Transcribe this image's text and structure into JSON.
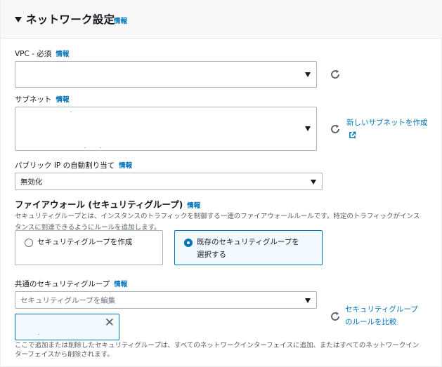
{
  "header": {
    "title": "ネットワーク設定",
    "info": "情報"
  },
  "vpc": {
    "label": "VPC - 必須",
    "info": "情報",
    "value": ""
  },
  "subnet": {
    "label": "サブネット",
    "info": "情報",
    "value": "",
    "create_link": "新しいサブネットを作成"
  },
  "public_ip": {
    "label": "パブリック IP の自動割り当て",
    "info": "情報",
    "value": "無効化"
  },
  "firewall": {
    "title": "ファイアウォール (セキュリティグループ)",
    "info": "情報",
    "description_line1": "セキュリティグループとは、インスタンスのトラフィックを制御する一連のファイアウォールルールです。特定のトラフィックがインス",
    "description_line2": "タンスに到達できるようにルールを追加します。",
    "option_create": "セキュリティグループを作成",
    "option_existing_line1": "既存のセキュリティグループを",
    "option_existing_line2": "選択する",
    "selected_option": "existing"
  },
  "common_sg": {
    "label": "共通のセキュリティグループ",
    "info": "情報",
    "placeholder": "セキュリティグループを編集",
    "compare_link_line1": "セキュリティグループ",
    "compare_link_line2": "のルールを比較",
    "token_value": "",
    "note_line1": "ここで追加または削除したセキュリティグループは、すべてのネットワークインターフェイスに追加、またはすべてのネットワークイン",
    "note_line2": "ターフェイスから削除されます。"
  },
  "icons": {
    "collapse": "caret-down-icon",
    "dropdown": "triangle-down-icon",
    "refresh": "refresh-icon",
    "external": "external-link-icon",
    "dismiss": "close-icon"
  },
  "colors": {
    "link": "#0073bb",
    "border": "#aab7b8",
    "selected_bg": "#f1faff",
    "header_bg": "#f8f8f8"
  }
}
